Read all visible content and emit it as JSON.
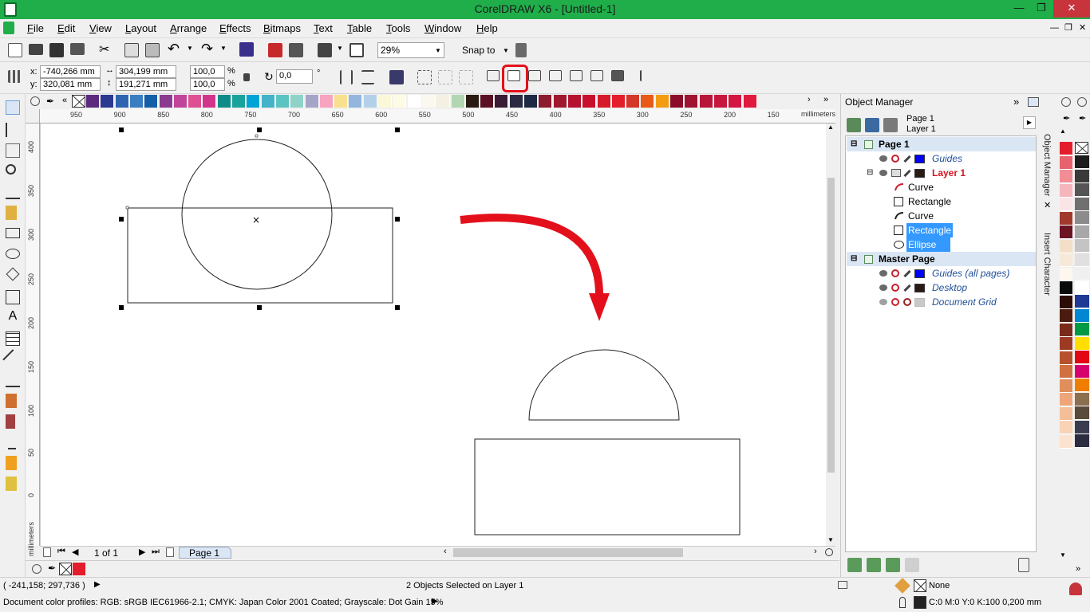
{
  "window": {
    "title": "CorelDRAW X6 - [Untitled-1]",
    "controls": {
      "minimize": "—",
      "restore": "❐",
      "close": "✕"
    }
  },
  "menu": [
    "File",
    "Edit",
    "View",
    "Layout",
    "Arrange",
    "Effects",
    "Bitmaps",
    "Text",
    "Table",
    "Tools",
    "Window",
    "Help"
  ],
  "standard_toolbar": {
    "zoom": "29%",
    "snap_to": "Snap to"
  },
  "property_bar": {
    "x_label": "x:",
    "y_label": "y:",
    "x": "-740,266 mm",
    "y": "320,081 mm",
    "width": "304,199 mm",
    "height": "191,271 mm",
    "scale_x": "100,0",
    "scale_y": "100,0",
    "percent": "%",
    "rotation": "0,0",
    "degree": "°"
  },
  "ruler": {
    "unit": "millimeters",
    "h_ticks": [
      "950",
      "900",
      "850",
      "800",
      "750",
      "700",
      "650",
      "600",
      "550",
      "500",
      "450",
      "400",
      "350",
      "300",
      "250",
      "200",
      "150"
    ],
    "v_ticks": [
      "400",
      "350",
      "300",
      "250",
      "200",
      "150",
      "100",
      "50",
      "0"
    ]
  },
  "palette_colors": [
    "#5c2a7e",
    "#2b3990",
    "#2f64b1",
    "#3a7dc1",
    "#145ea8",
    "#8a3b8f",
    "#c1449b",
    "#df4f93",
    "#d2348c",
    "#0f8c8a",
    "#1aa39a",
    "#00a4d6",
    "#44b2c8",
    "#5bc3c2",
    "#8fd3c8",
    "#a5a5c8",
    "#f6a4c0",
    "#f8e08e",
    "#92b6de",
    "#b4d0e9",
    "#fbf7d9",
    "#fdfbe6",
    "#ffffff",
    "#fbf8f0",
    "#f5f0e1",
    "#b2d6b2",
    "#2b1a12",
    "#5a0f24",
    "#3a1c36",
    "#2a2a42",
    "#1e2a44",
    "#8c1b2e",
    "#a0182e",
    "#b51230",
    "#c8102e",
    "#d61a2a",
    "#e31d2c",
    "#d4362a",
    "#e85a16",
    "#f39c12",
    "#8b0d2a",
    "#a01432",
    "#b7153a",
    "#c6173e",
    "#d41742",
    "#e2193f"
  ],
  "canvas": {
    "shapes_before": "rectangle and ellipse overlapping",
    "result_after": "semicircle and rectangle"
  },
  "navigator": {
    "page_count": "1 of 1",
    "page_tab": "Page 1"
  },
  "object_manager": {
    "title": "Object Manager",
    "current_page": "Page 1",
    "current_layer": "Layer 1",
    "page1": {
      "label": "Page 1",
      "items": [
        {
          "name": "Guides",
          "color": "#0000ff",
          "style": "italic"
        },
        {
          "name": "Layer 1",
          "color": "#2b1a14",
          "style": "active"
        }
      ],
      "objects": [
        {
          "name": "Curve",
          "icon": "curve-icon",
          "selected": false
        },
        {
          "name": "Rectangle",
          "icon": "rectangle-icon",
          "selected": false
        },
        {
          "name": "Curve",
          "icon": "curve-icon",
          "selected": false
        },
        {
          "name": "Rectangle",
          "icon": "rectangle-icon",
          "selected": true
        },
        {
          "name": "Ellipse",
          "icon": "ellipse-icon",
          "selected": true
        }
      ]
    },
    "master_page": {
      "label": "Master Page",
      "items": [
        {
          "name": "Guides (all pages)",
          "color": "#0000ff"
        },
        {
          "name": "Desktop",
          "color": "#2b1a14"
        },
        {
          "name": "Document Grid",
          "color": "#c8c8c8"
        }
      ]
    }
  },
  "side_tabs": [
    "Object Manager",
    "Insert Character"
  ],
  "right_palette_col1": [
    "#e31d2c",
    "#e8626e",
    "#f08d95",
    "#f5b6bb",
    "#fbe4e6",
    "#a13a2c",
    "#6b1424",
    "#f3dfc8",
    "#f7e9d9",
    "#fdf7ef",
    "#0a0a0a",
    "#2c0d05",
    "#4a1b0e",
    "#7a2a1a",
    "#9c3b22",
    "#b7512c",
    "#d07040",
    "#e08e5c",
    "#eea679",
    "#f4bf98",
    "#f8d3b6",
    "#fbe3cf"
  ],
  "right_palette_col2": [
    "#ffffff",
    "#1c1c1c",
    "#3a3a3a",
    "#555555",
    "#707070",
    "#8c8c8c",
    "#a8a8a8",
    "#c4c4c4",
    "#e0e0e0",
    "#f0f0f0",
    "#ffffff",
    "#1f3a93",
    "#0087d2",
    "#009a44",
    "#ffde00",
    "#e30613",
    "#d5006d",
    "#ef7d00",
    "#8b6f4e",
    "#5a4a3a",
    "#3c3c50",
    "#2c2c40"
  ],
  "status": {
    "cursor": "( -241,158; 297,736 )",
    "selection": "2 Objects Selected on Layer 1",
    "color_profiles": "Document color profiles: RGB: sRGB IEC61966-2.1; CMYK: Japan Color 2001 Coated; Grayscale: Dot Gain 15%",
    "fill": "None",
    "outline": "C:0 M:0 Y:0 K:100  0,200 mm"
  },
  "doc_palette": [
    "#e31d2c"
  ]
}
